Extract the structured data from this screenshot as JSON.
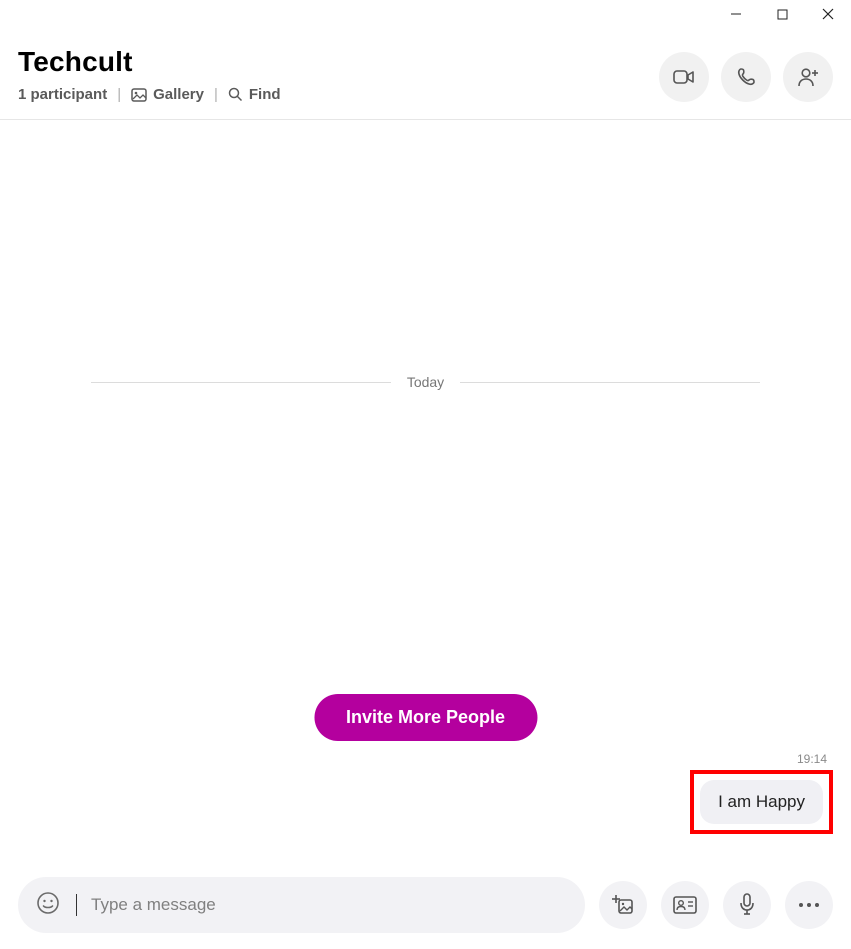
{
  "window": {
    "minimize": "minimize",
    "maximize": "maximize",
    "close": "close"
  },
  "header": {
    "title": "Techcult",
    "participant_label": "1 participant",
    "gallery_label": "Gallery",
    "find_label": "Find",
    "separator": "|"
  },
  "actions": {
    "video_call": "video-call",
    "audio_call": "audio-call",
    "add_person": "add-person"
  },
  "chat": {
    "day_label": "Today",
    "invite_button": "Invite More People",
    "messages": [
      {
        "time": "19:14",
        "text": "I am Happy",
        "outgoing": true,
        "highlighted": true
      }
    ]
  },
  "composer": {
    "placeholder": "Type a message"
  }
}
